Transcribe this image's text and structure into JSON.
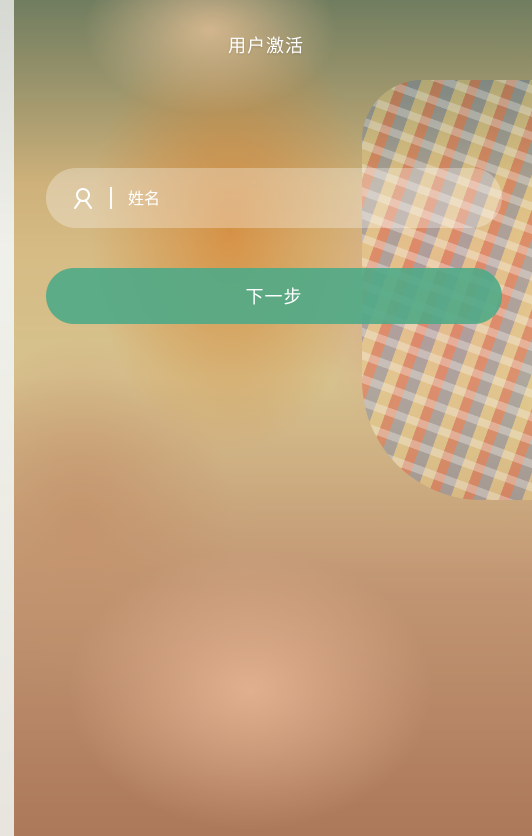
{
  "header": {
    "title": "用户激活"
  },
  "form": {
    "name_placeholder": "姓名",
    "name_value": "",
    "user_icon": "user-icon",
    "next_label": "下一步"
  },
  "colors": {
    "button_green": "#4FAA87",
    "input_bg": "rgba(255,255,255,0.30)",
    "text": "#FFFFFF"
  }
}
